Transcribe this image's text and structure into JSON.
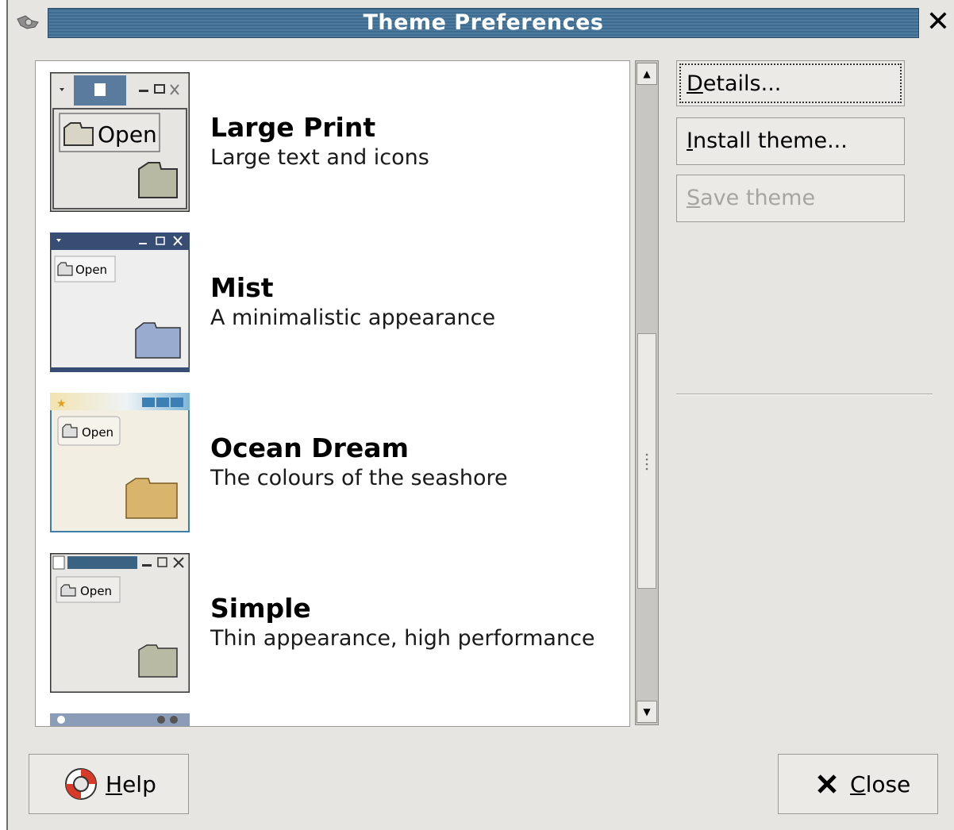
{
  "window": {
    "title": "Theme Preferences"
  },
  "themes": [
    {
      "name": "Large Print",
      "description": "Large text and icons",
      "preview_label": "Open"
    },
    {
      "name": "Mist",
      "description": "A minimalistic appearance",
      "preview_label": "Open"
    },
    {
      "name": "Ocean Dream",
      "description": "The colours of the seashore",
      "preview_label": "Open"
    },
    {
      "name": "Simple",
      "description": "Thin appearance, high performance",
      "preview_label": "Open"
    }
  ],
  "buttons": {
    "details": {
      "mnemonic": "D",
      "rest": "etails..."
    },
    "install": {
      "mnemonic": "I",
      "rest": "nstall theme..."
    },
    "save": {
      "mnemonic": "S",
      "rest": "ave theme"
    },
    "help": {
      "mnemonic": "H",
      "rest": "elp"
    },
    "close": {
      "mnemonic": "C",
      "rest": "lose"
    }
  },
  "icons": {
    "window_menu": "window-menu-icon",
    "window_close": "close-icon",
    "help": "lifebuoy-icon",
    "close": "x-icon"
  },
  "colors": {
    "titlebar": "#3f6b8f",
    "dialog_bg": "#e6e5e1",
    "list_bg": "#ffffff"
  }
}
